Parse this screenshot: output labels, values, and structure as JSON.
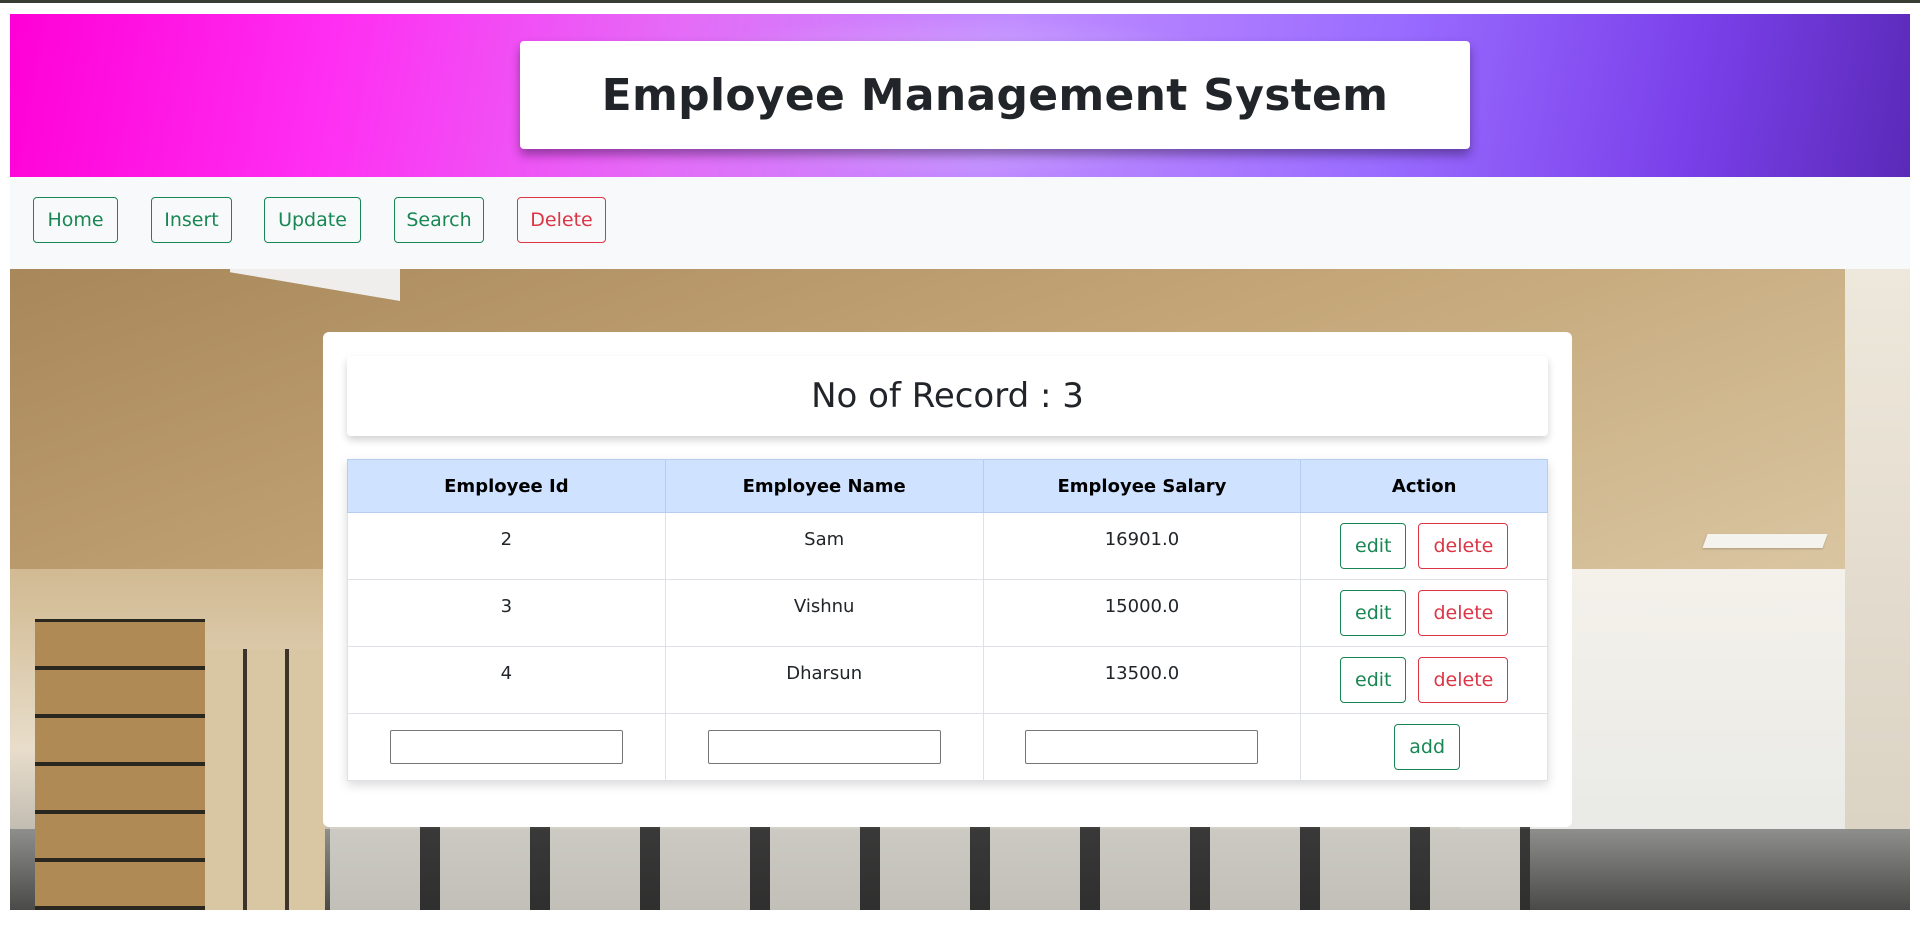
{
  "header": {
    "title": "Employee Management System"
  },
  "nav": {
    "home": "Home",
    "insert": "Insert",
    "update": "Update",
    "search": "Search",
    "delete": "Delete"
  },
  "record_count_label": "No of Record : 3",
  "table": {
    "columns": [
      "Employee Id",
      "Employee Name",
      "Employee Salary",
      "Action"
    ],
    "rows": [
      {
        "id": "2",
        "name": "Sam",
        "salary": "16901.0"
      },
      {
        "id": "3",
        "name": "Vishnu",
        "salary": "15000.0"
      },
      {
        "id": "4",
        "name": "Dharsun",
        "salary": "13500.0"
      }
    ],
    "edit_label": "edit",
    "delete_label": "delete",
    "add_label": "add"
  },
  "colors": {
    "primary_green": "#198754",
    "danger_red": "#dc3545",
    "table_header_bg": "#cfe2ff"
  }
}
